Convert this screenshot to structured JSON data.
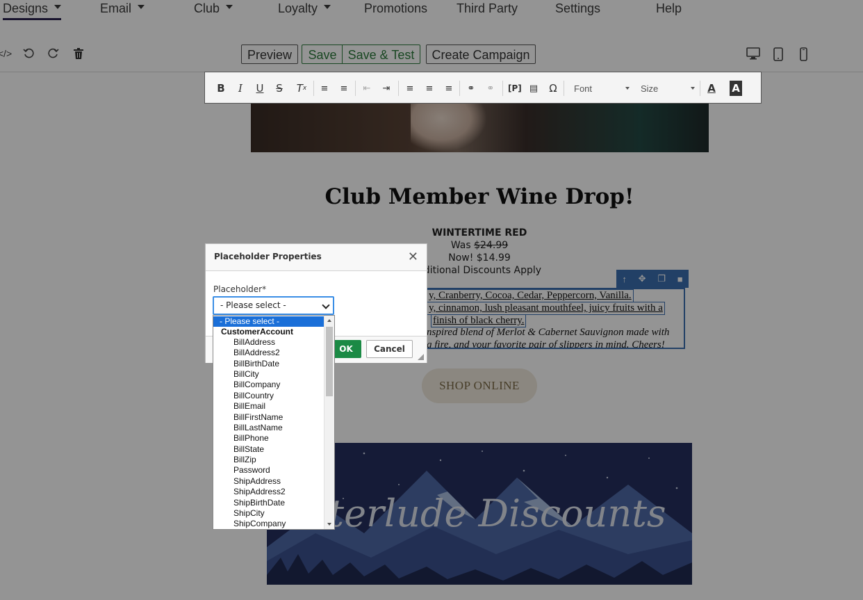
{
  "nav": {
    "items": [
      {
        "label": "Designs",
        "has_caret": true
      },
      {
        "label": "Email",
        "has_caret": true
      },
      {
        "label": "Club",
        "has_caret": true
      },
      {
        "label": "Loyalty",
        "has_caret": true
      },
      {
        "label": "Promotions",
        "has_caret": false
      },
      {
        "label": "Third Party",
        "has_caret": false
      },
      {
        "label": "Settings",
        "has_caret": false
      },
      {
        "label": "Help",
        "has_caret": false
      }
    ],
    "active": "Designs"
  },
  "toolbar": {
    "code_icon": "code-icon",
    "undo_icon": "undo-icon",
    "redo_icon": "redo-icon",
    "delete_icon": "trash-icon",
    "preview_label": "Preview",
    "save_label": "Save",
    "save_test_label": "Save & Test",
    "create_campaign_label": "Create Campaign",
    "devices": [
      "desktop-icon",
      "tablet-icon",
      "mobile-icon"
    ]
  },
  "rte": {
    "font_label": "Font",
    "size_label": "Size"
  },
  "email": {
    "title": "Club Member Wine Drop!",
    "product_name": "WINTERTIME RED",
    "was_label": "Was",
    "was_price": "$24.99",
    "now_text": "Now! $14.99",
    "discount_text": "dditional Discounts Apply",
    "desc_lines": [
      "y, Cranberry, Cocoa, Cedar, Peppercorn, Vanilla.",
      "y, cinnamon, lush pleasant mouthfeel, juicy fruits with a",
      "finish of black cherry.",
      "nspired blend of Merlot & Cabernet Sauvignon made with",
      "g fire, and your favorite pair of slippers in mind. Cheers!"
    ],
    "shop_button": "SHOP ONLINE",
    "banner_text": "interlude Discounts"
  },
  "dialog": {
    "title": "Placeholder Properties",
    "field_label": "Placeholder*",
    "selected": "- Please select -",
    "ok_label": "OK",
    "cancel_label": "Cancel"
  },
  "dropdown": {
    "options": [
      {
        "label": "- Please select -",
        "type": "selected"
      },
      {
        "label": "CustomerAccount",
        "type": "group"
      },
      {
        "label": "BillAddress",
        "type": "option"
      },
      {
        "label": "BillAddress2",
        "type": "option"
      },
      {
        "label": "BillBirthDate",
        "type": "option"
      },
      {
        "label": "BillCity",
        "type": "option"
      },
      {
        "label": "BillCompany",
        "type": "option"
      },
      {
        "label": "BillCountry",
        "type": "option"
      },
      {
        "label": "BillEmail",
        "type": "option"
      },
      {
        "label": "BillFirstName",
        "type": "option"
      },
      {
        "label": "BillLastName",
        "type": "option"
      },
      {
        "label": "BillPhone",
        "type": "option"
      },
      {
        "label": "BillState",
        "type": "option"
      },
      {
        "label": "BillZip",
        "type": "option"
      },
      {
        "label": "Password",
        "type": "option"
      },
      {
        "label": "ShipAddress",
        "type": "option"
      },
      {
        "label": "ShipAddress2",
        "type": "option"
      },
      {
        "label": "ShipBirthDate",
        "type": "option"
      },
      {
        "label": "ShipCity",
        "type": "option"
      },
      {
        "label": "ShipCompany",
        "type": "option"
      }
    ]
  },
  "colors": {
    "accent_blue": "#3c6fb0",
    "ok_green": "#1b8a45",
    "selected_blue": "#1a6fd8",
    "nav_active": "#2c2450"
  }
}
